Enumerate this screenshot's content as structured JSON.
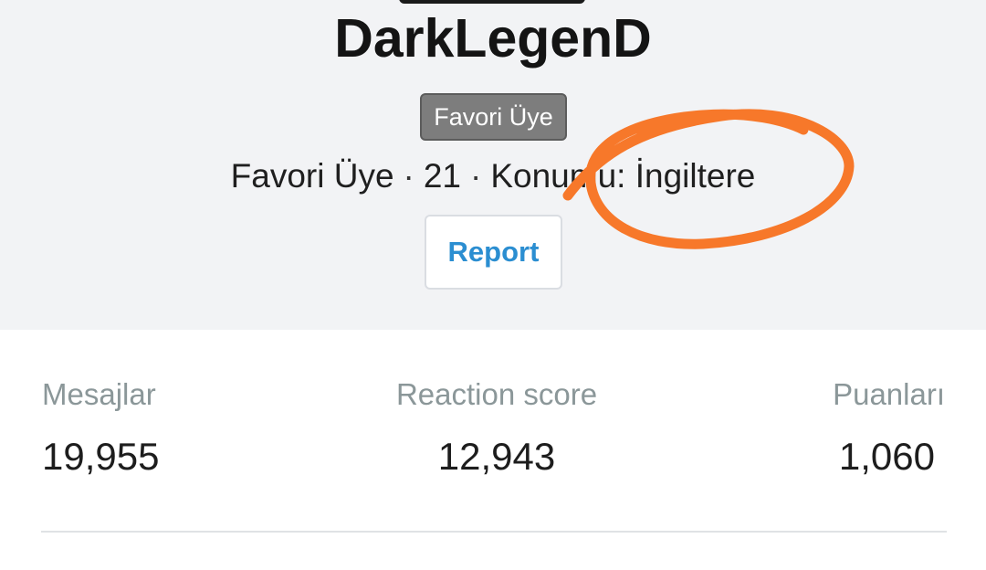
{
  "profile": {
    "username": "DarkLegenD",
    "badge": "Favori Üye",
    "meta": {
      "title": "Favori Üye",
      "age": "21",
      "location_label": "Konumu:",
      "location": "İngiltere"
    },
    "report_label": "Report"
  },
  "annotation": {
    "color": "#f7782a"
  },
  "stats": [
    {
      "label": "Mesajlar",
      "value": "19,955"
    },
    {
      "label": "Reaction score",
      "value": "12,943"
    },
    {
      "label": "Puanları",
      "value": "1,060"
    }
  ]
}
